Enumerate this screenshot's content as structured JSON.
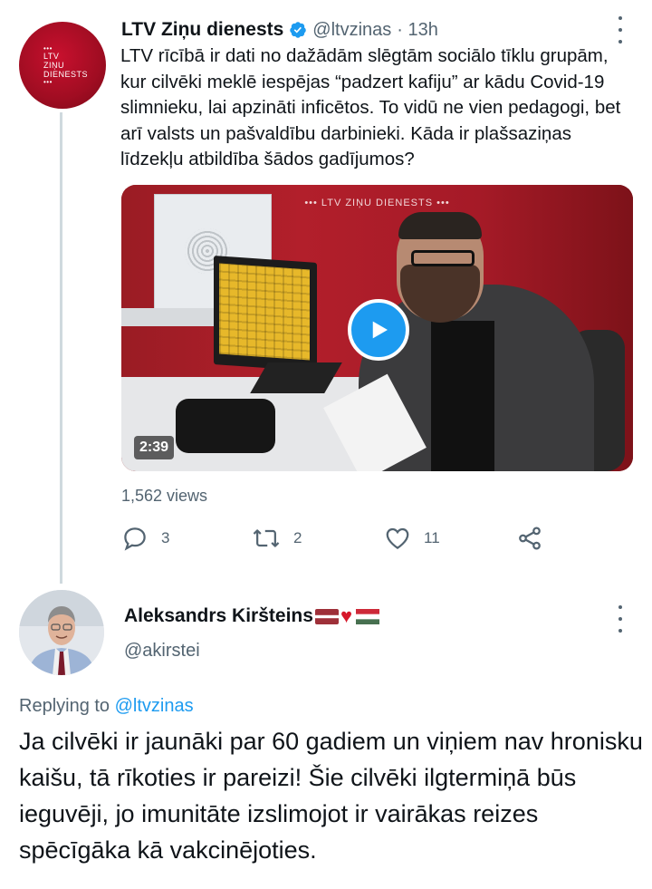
{
  "tweet": {
    "author_name": "LTV Ziņu dienests",
    "author_handle": "@ltvzinas",
    "time": "· 13h",
    "avatar_logo_lines": [
      "LTV",
      "ZIŅU",
      "DIENESTS"
    ],
    "verified_icon": "verified-badge-icon",
    "text": "LTV rīcībā ir dati no dažādām slēgtām sociālo tīklu grupām, kur cilvēki meklē iespējas “padzert kafiju” ar kādu Covid-19 slimnieku, lai apzināti inficētos. To vidū ne vien pedagogi, bet arī valsts un pašvaldību darbinieki. Kāda ir plašsaziņas līdzekļu atbildība šādos gadījumos?",
    "video": {
      "watermark": "••• LTV ZIŅU DIENESTS •••",
      "duration": "2:39",
      "play_icon": "play-icon"
    },
    "views": "1,562 views",
    "actions": {
      "reply_count": "3",
      "retweet_count": "2",
      "like_count": "11"
    },
    "colors": {
      "accent": "#1d9bf0",
      "secondary_text": "#536471",
      "brand_red": "#c8102e"
    }
  },
  "reply": {
    "author_name": "Aleksandrs Kiršteins",
    "author_handle": "@akirstei",
    "name_emojis": [
      "latvia-flag-icon",
      "red-heart-icon",
      "hungary-flag-icon"
    ],
    "replying_prefix": "Replying to ",
    "replying_to": "@ltvzinas",
    "text": "Ja cilvēki ir jaunāki par 60 gadiem un viņiem nav hronisku kaišu, tā rīkoties ir pareizi! Šie cilvēki ilgtermiņā būs ieguvēji, jo imunitāte izslimojot ir vairākas reizes spēcīgāka kā vakcinējoties."
  }
}
